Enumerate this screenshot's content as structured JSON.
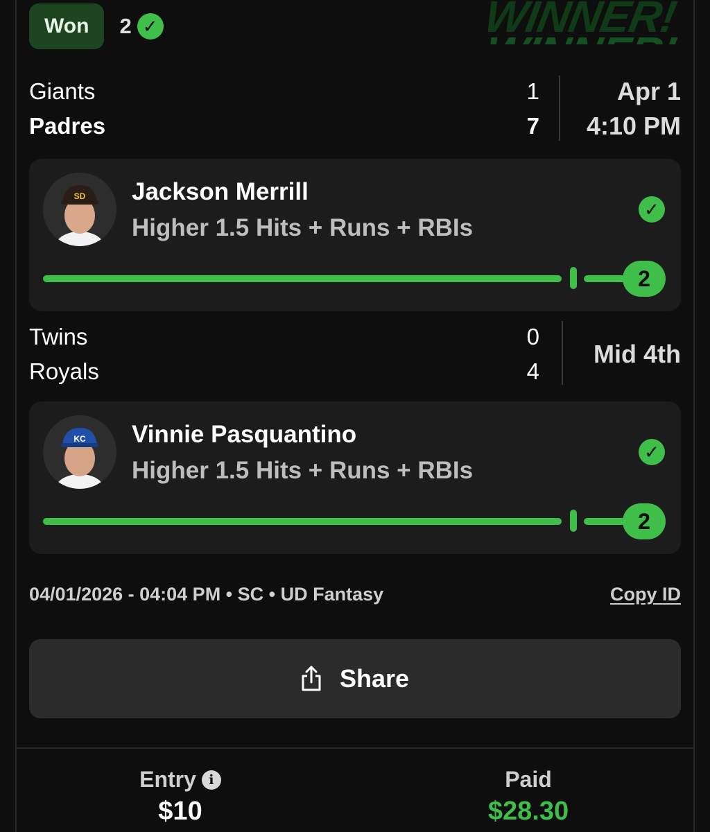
{
  "header": {
    "status_badge": "Won",
    "wins_count": "2"
  },
  "accent_color": "#3fbe4a",
  "games": [
    {
      "teams": [
        {
          "name": "Giants",
          "score": "1"
        },
        {
          "name": "Padres",
          "score": "7"
        }
      ],
      "info_line1": "Apr 1",
      "info_line2": "4:10 PM",
      "pick": {
        "player": "Jackson Merrill",
        "line": "Higher 1.5  Hits + Runs + RBIs",
        "result_value": "2",
        "line_value": 1.5,
        "actual_value": 2,
        "cap_icon": "padres-cap"
      }
    },
    {
      "teams": [
        {
          "name": "Twins",
          "score": "0"
        },
        {
          "name": "Royals",
          "score": "4"
        }
      ],
      "info_line1": "Mid 4th",
      "pick": {
        "player": "Vinnie Pasquantino",
        "line": "Higher 1.5  Hits + Runs + RBIs",
        "result_value": "2",
        "line_value": 1.5,
        "actual_value": 2,
        "cap_icon": "royals-cap"
      }
    }
  ],
  "meta": {
    "info": "04/01/2026 - 04:04 PM • SC • UD Fantasy",
    "copy_id": "Copy ID"
  },
  "share": {
    "label": "Share"
  },
  "footer": {
    "entry_label": "Entry",
    "entry_value": "$10",
    "paid_label": "Paid",
    "paid_value": "$28.30"
  }
}
